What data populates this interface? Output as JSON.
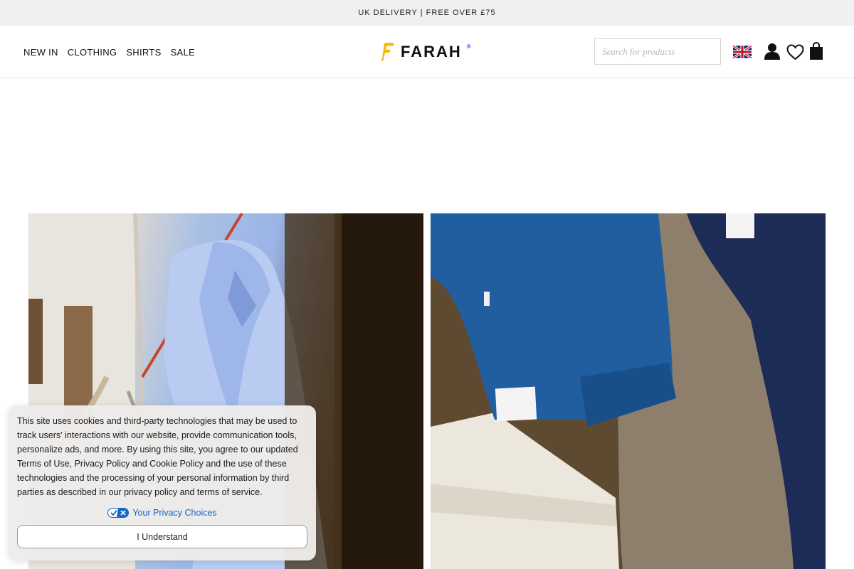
{
  "promo": {
    "text": "UK DELIVERY | FREE OVER £75"
  },
  "nav": {
    "items": [
      {
        "label": "NEW IN"
      },
      {
        "label": "CLOTHING"
      },
      {
        "label": "SHIRTS"
      },
      {
        "label": "SALE"
      }
    ]
  },
  "brand": {
    "name": "FARAH",
    "registered": "®",
    "accent_color": "#f2b600"
  },
  "search": {
    "placeholder": "Search for products",
    "value": ""
  },
  "header_icons": [
    "uk-flag-icon",
    "account-icon",
    "heart-icon",
    "shopping-bag-icon"
  ],
  "hero": {
    "left_image": "blue-striped-shirt-on-hanger",
    "right_image": "folded-trousers-blue-cream-khaki"
  },
  "cookie_banner": {
    "text": "This site uses cookies and third-party technologies that may be used to track users' interactions with our website, provide communication tools, personalize ads, and more. By using this site, you agree to our updated Terms of Use, Privacy Policy and Cookie Policy and the use of these technologies and the processing of your personal information by third parties as described in our privacy policy and terms of service.",
    "privacy_choices_label": "Your Privacy Choices",
    "accept_label": "I Understand",
    "link_color": "#1666c4"
  }
}
